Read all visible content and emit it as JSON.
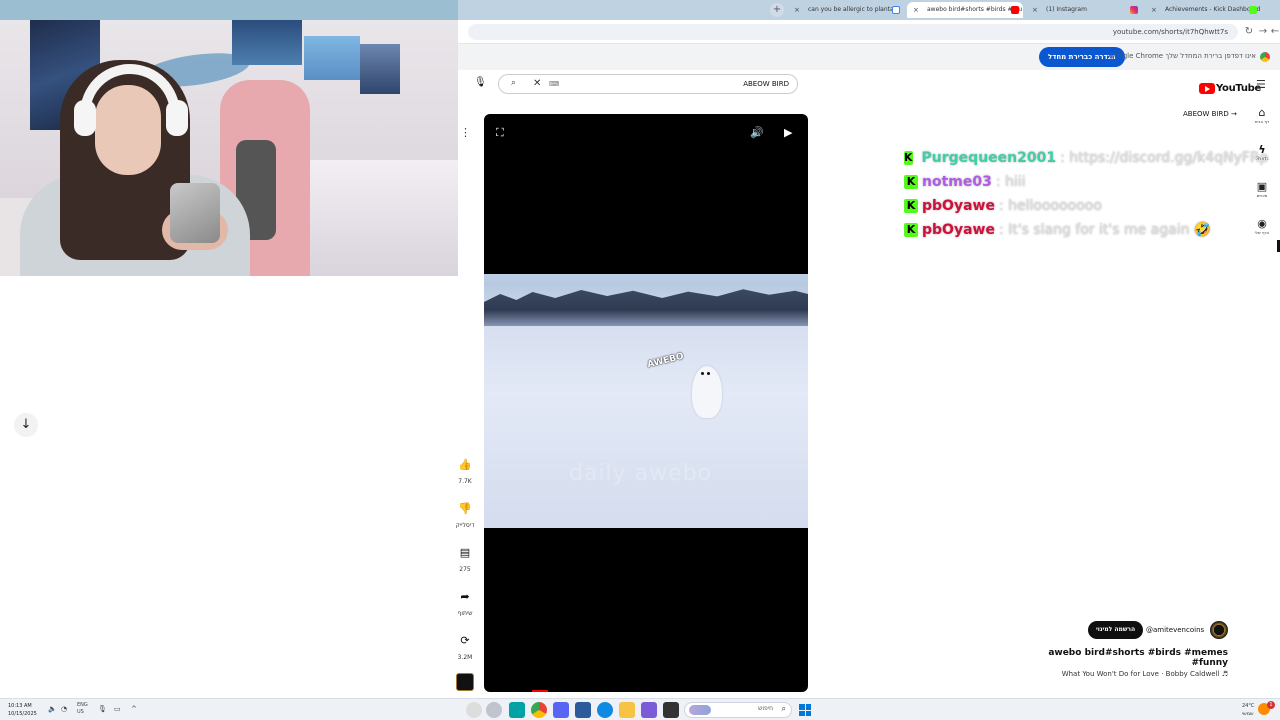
{
  "browser": {
    "tabs": [
      {
        "title": "can you be allergic to plantain",
        "active": false
      },
      {
        "title": "awebo bird#shorts #birds #mu",
        "active": true
      },
      {
        "title": "(1) Instagram",
        "active": false
      },
      {
        "title": "Achievements - Kick Dashboard",
        "active": false
      }
    ],
    "new_tab_icon": "+",
    "url": "youtube.com/shorts/it7hQhwtt7s",
    "infobar_message": "Google Chrome אינו דפדפן ברירת המחדל שלך",
    "infobar_button": "הגדרה כברירת מחדל"
  },
  "youtube": {
    "logo_text": "YouTube",
    "search_query": "ABEOW BIRD",
    "channel_link": "ABEOW BIRD",
    "rail": [
      {
        "icon": "home-icon",
        "label": "דף הבית"
      },
      {
        "icon": "shorts-icon",
        "label": "Shorts"
      },
      {
        "icon": "subscriptions-icon",
        "label": "מינויים"
      },
      {
        "icon": "you-icon",
        "label": "הדף שלי"
      }
    ],
    "video": {
      "sticker_text": "AWEBO",
      "watermark": "daily awebo"
    },
    "actions": {
      "likes": "7.7K",
      "dislike_label": "דיסלייק",
      "comments": "275",
      "share_label": "שיתוף",
      "remix": "3.2M"
    },
    "subscribe_label": "הרשמה למינוי",
    "channel_handle": "@amitevencoins",
    "title": "awebo bird#shorts #birds #memes #funny",
    "music": "What You Won't Do for Love · Bobby Caldwell ♬"
  },
  "chat": [
    {
      "user": "Purgequeen2001",
      "color": "#3fcfa6",
      "text": ": https://discord.gg/k4qNyFRp",
      "extra_badge": true
    },
    {
      "user": "notme03",
      "color": "#b05be8",
      "text": ": hiii",
      "extra_badge": false
    },
    {
      "user": "pbOyawe",
      "color": "#d0103a",
      "text": ": helloooooooo",
      "extra_badge": false
    },
    {
      "user": "pbOyawe",
      "color": "#d0103a",
      "text": ": It's slang for it's me again 🤣",
      "extra_badge": false
    }
  ],
  "taskbar": {
    "time": "10:13 AM",
    "date": "10/15/2025",
    "lang": "ENG",
    "region": "US",
    "search_placeholder": "חיפוש",
    "weather_temp": "24°C",
    "weather_desc": "שמשי",
    "notification_count": "1"
  },
  "colors": {
    "kick_green": "#53fc18",
    "yt_red": "#ff0000",
    "chrome_blue": "#0b57d0"
  }
}
